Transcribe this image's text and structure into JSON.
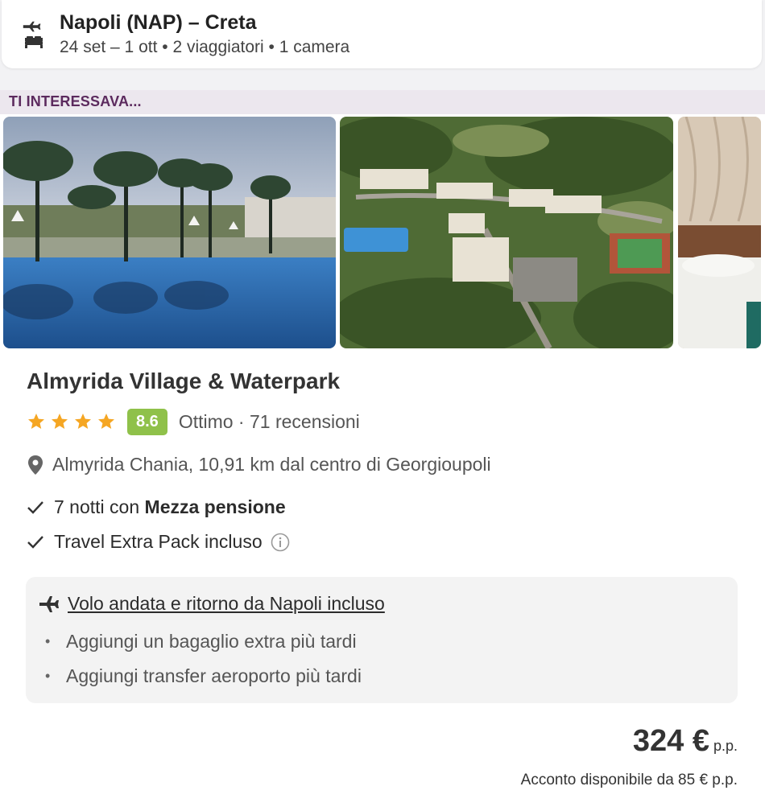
{
  "search": {
    "title": "Napoli (NAP) – Creta",
    "details": "24 set – 1 ott • 2 viaggiatori • 1 camera"
  },
  "section": {
    "label": "TI INTERESSAVA..."
  },
  "hotel": {
    "name": "Almyrida Village & Waterpark",
    "stars": 4,
    "score": "8.6",
    "rating_text": "Ottimo · 71 recensioni",
    "location": "Almyrida Chania, 10,91 km dal centro di Georgioupoli",
    "features": [
      {
        "prefix": "7 notti con ",
        "bold": "Mezza pensione"
      },
      {
        "prefix": "Travel Extra Pack incluso",
        "bold": ""
      }
    ],
    "flight": {
      "title": "Volo andata e ritorno da Napoli incluso",
      "extras": [
        "Aggiungi un bagaglio extra più tardi",
        "Aggiungi transfer aeroporto più tardi"
      ]
    },
    "price": {
      "value": "324 €",
      "unit": "p.p.",
      "deposit": "Acconto disponibile da 85 € p.p."
    }
  },
  "colors": {
    "accent": "#5c2a5e",
    "score": "#8fc14a",
    "star": "#f5a623"
  }
}
